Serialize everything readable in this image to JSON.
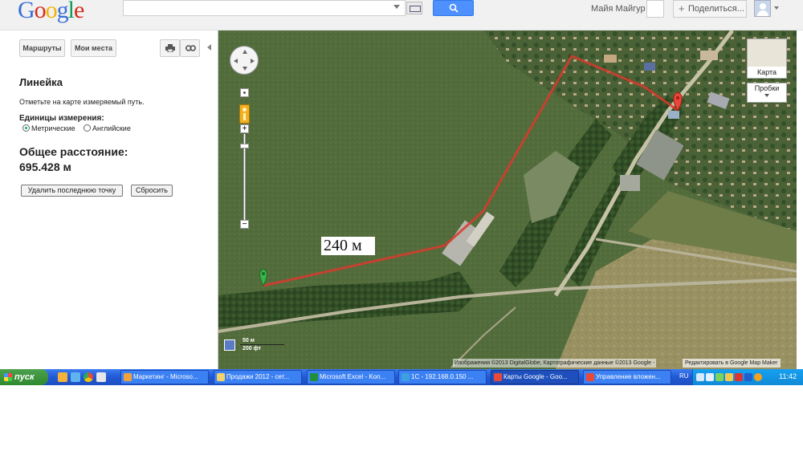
{
  "header": {
    "logo_letters": [
      {
        "ch": "G",
        "color": "#3b6fd6"
      },
      {
        "ch": "o",
        "color": "#d62d20"
      },
      {
        "ch": "o",
        "color": "#f4b400"
      },
      {
        "ch": "g",
        "color": "#3b6fd6"
      },
      {
        "ch": "l",
        "color": "#0f9d58"
      },
      {
        "ch": "e",
        "color": "#d62d20"
      }
    ],
    "search_value": "",
    "user_name": "Майя Майгур",
    "share_label": "Поделиться..."
  },
  "panel": {
    "routes_label": "Маршруты",
    "myplaces_label": "Мои места",
    "ruler_title": "Линейка",
    "ruler_hint": "Отметьте на карте измеряемый путь.",
    "units_label": "Единицы измерения:",
    "unit_metric": "Метрические",
    "unit_english": "Английские",
    "selected_unit": "metric",
    "total_label": "Общее расстояние:",
    "total_value": "695.428 м",
    "remove_last_label": "Удалить последнюю точку",
    "reset_label": "Сбросить"
  },
  "map": {
    "map_type_label": "Карта",
    "traffic_label": "Пробки",
    "distance_label": "240 м",
    "scale_m": "50 м",
    "scale_ft": "200 фт",
    "copyright": "Изображения ©2013 DigitalGlobe, Картографические данные ©2013 Google -",
    "report_link": "Редактировать в Google Map Maker",
    "route_color": "#d93a2e"
  },
  "taskbar": {
    "start_label": "пуск",
    "tasks": [
      {
        "label": "Маркетинг - Microso...",
        "icon_color": "#f2a23a",
        "active": false
      },
      {
        "label": "Продажи 2012 - сет...",
        "icon_color": "#f5d36a",
        "active": false
      },
      {
        "label": "Microsoft Excel - Kon...",
        "icon_color": "#1f8f3a",
        "active": false
      },
      {
        "label": "1С - 192.168.0.150 ...",
        "icon_color": "#3aa0e0",
        "active": false
      },
      {
        "label": "Карты Google - Goo...",
        "icon_color": "#e84a3a",
        "active": true
      },
      {
        "label": "Управление вложен...",
        "icon_color": "#e84a3a",
        "active": false
      }
    ],
    "language": "RU",
    "clock": "11:42"
  }
}
